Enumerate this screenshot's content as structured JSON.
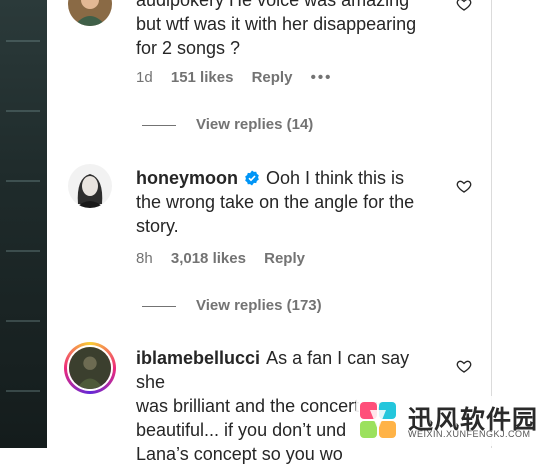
{
  "comments": [
    {
      "username": "audipokery",
      "text": "He voice was amazing but wtf was it with her disappearing for 2 songs ?",
      "lines": [
        "audipokery He voice was amazing",
        "but wtf was it with her disappearing",
        "for 2 songs ?"
      ],
      "time": "1d",
      "likes": "151 likes",
      "reply_label": "Reply",
      "more_label": "•••",
      "view_replies": "View replies (14)"
    },
    {
      "username": "honeymoon",
      "verified": true,
      "text": "Ooh I think this is the wrong take on the angle for the story.",
      "line1_rest": "Ooh I think this is",
      "lines_rest": [
        "the wrong take on the angle for the",
        "story."
      ],
      "time": "8h",
      "likes": "3,018 likes",
      "reply_label": "Reply",
      "view_replies": "View replies (173)"
    },
    {
      "username": "iblamebellucci",
      "text": "As a fan I can say she was brilliant and the concert was beautiful... if you don't und Lana's concept so you wo",
      "line1_rest": "As a fan I can say she",
      "lines_rest": [
        "was brilliant and the concert was",
        "beautiful... if you don’t und",
        "Lana’s concept so you wo"
      ]
    }
  ],
  "watermark": {
    "title": "迅风软件园",
    "url": "WEIXIN.XUNFENGKJ.COM"
  },
  "colors": {
    "text": "#262626",
    "secondary": "#737373",
    "verified": "#0095f6"
  }
}
